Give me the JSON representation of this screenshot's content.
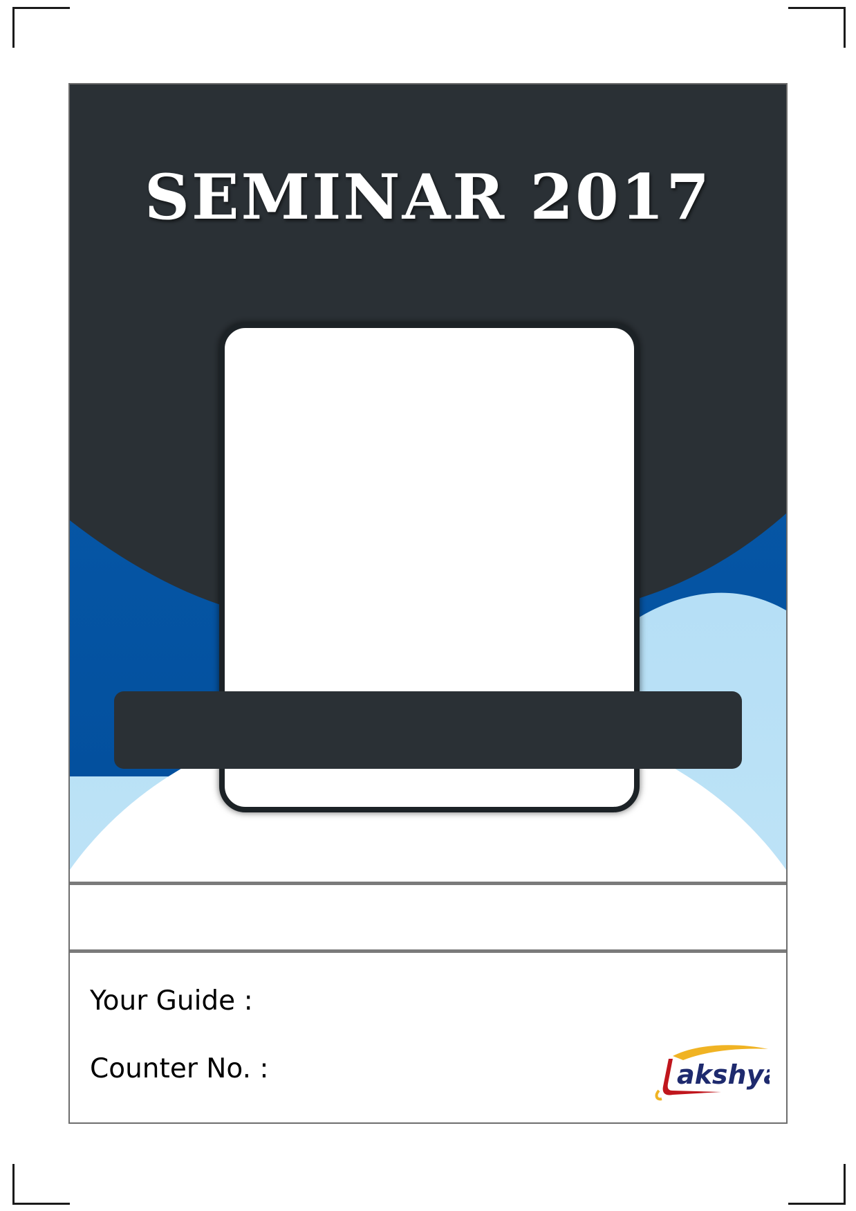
{
  "title": "SEMINAR 2017",
  "fields": {
    "guide_label": "Your Guide :",
    "counter_label": "Counter No. :"
  },
  "logo": {
    "text": "Lakshya",
    "icon": "lakshya-logo"
  },
  "colors": {
    "dark": "#2a3035",
    "blue": "#0558a8",
    "light_blue": "#b3def5",
    "logo_red": "#c0161d",
    "logo_navy": "#1e2a6e",
    "logo_gold": "#f0b323"
  }
}
